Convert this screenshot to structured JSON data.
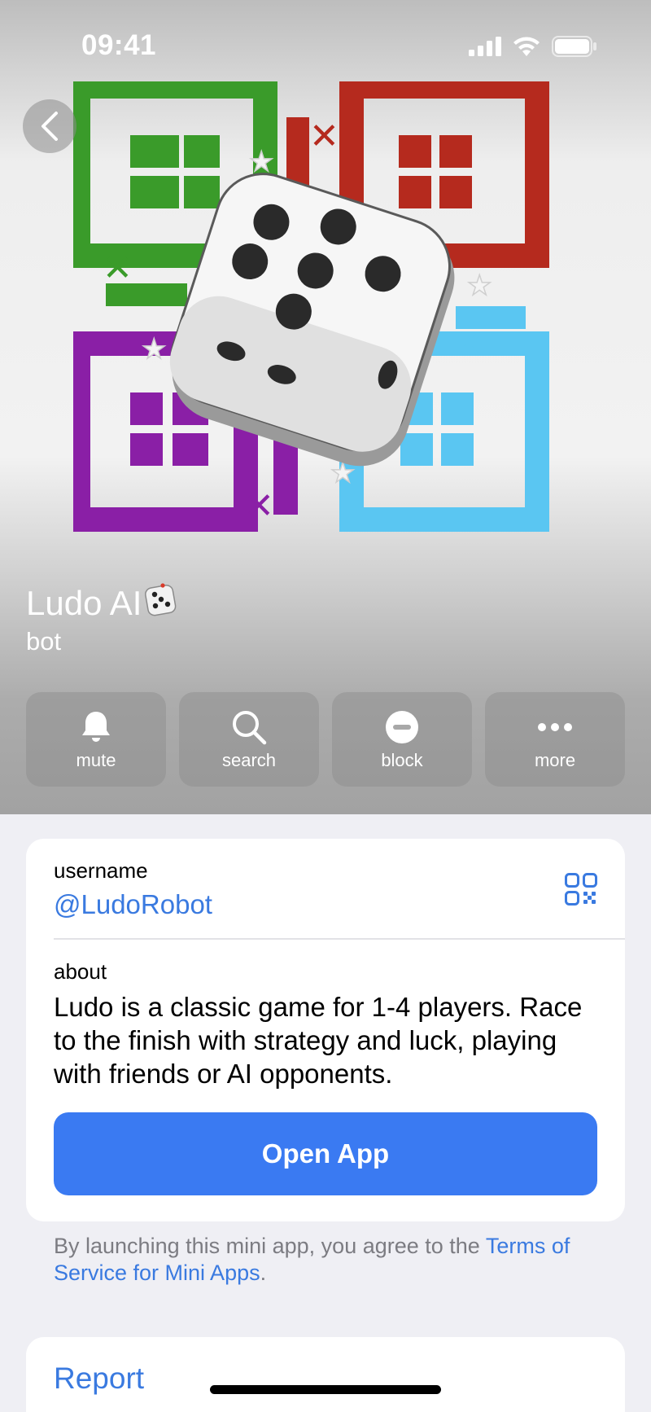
{
  "status_bar": {
    "time": "09:41",
    "icons": [
      "signal-icon",
      "wifi-icon",
      "battery-icon"
    ]
  },
  "header": {
    "back_icon": "chevron-left-icon",
    "bot_name": "Ludo AI",
    "bot_name_emoji": "🎲",
    "bot_kind": "bot",
    "colors": {
      "green": "#3a9b2a",
      "red": "#b52a1e",
      "purple": "#8a1fa6",
      "blue": "#5ac6f2"
    }
  },
  "actions": [
    {
      "label": "mute",
      "icon": "bell-icon"
    },
    {
      "label": "search",
      "icon": "search-icon"
    },
    {
      "label": "block",
      "icon": "block-icon"
    },
    {
      "label": "more",
      "icon": "more-icon"
    }
  ],
  "info": {
    "username_label": "username",
    "username": "@LudoRobot",
    "about_label": "about",
    "about_text": "Ludo is a classic game for 1-4 players. Race to the finish with strategy and luck, playing with friends or AI opponents.",
    "open_app_label": "Open App",
    "accent": "#3a7af2"
  },
  "terms": {
    "prefix": "By launching this mini app, you agree to the ",
    "link": "Terms of Service for Mini Apps",
    "suffix": "."
  },
  "report": {
    "label": "Report"
  }
}
